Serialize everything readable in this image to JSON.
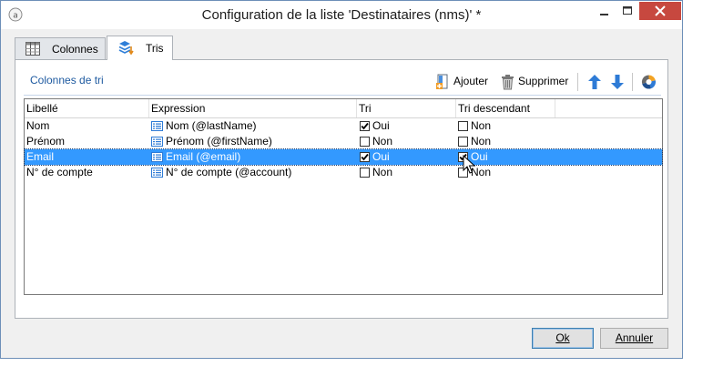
{
  "window": {
    "title": "Configuration de la liste 'Destinataires (nms)' *"
  },
  "tabs": [
    {
      "label": "Colonnes",
      "icon": "columns-icon",
      "active": false
    },
    {
      "label": "Tris",
      "icon": "sort-icon",
      "active": true
    }
  ],
  "section": {
    "title": "Colonnes de tri"
  },
  "toolbar": {
    "add_label": "Ajouter",
    "delete_label": "Supprimer",
    "up_icon": "arrow-up-icon",
    "down_icon": "arrow-down-icon",
    "chart_icon": "distribution-icon"
  },
  "grid": {
    "headers": [
      "Libellé",
      "Expression",
      "Tri",
      "Tri descendant"
    ],
    "rows": [
      {
        "label": "Nom",
        "expression": "Nom (@lastName)",
        "sort": true,
        "sort_label": "Oui",
        "desc": false,
        "desc_label": "Non",
        "selected": false
      },
      {
        "label": "Prénom",
        "expression": "Prénom (@firstName)",
        "sort": false,
        "sort_label": "Non",
        "desc": false,
        "desc_label": "Non",
        "selected": false
      },
      {
        "label": "Email",
        "expression": "Email (@email)",
        "sort": true,
        "sort_label": "Oui",
        "desc": true,
        "desc_label": "Oui",
        "selected": true
      },
      {
        "label": "N° de compte",
        "expression": "N° de compte (@account)",
        "sort": false,
        "sort_label": "Non",
        "desc": false,
        "desc_label": "Non",
        "selected": false
      }
    ]
  },
  "footer": {
    "ok_label": "Ok",
    "cancel_label": "Annuler"
  },
  "colors": {
    "selection": "#3399ff",
    "close_button": "#c7483f",
    "section_title": "#1e5aa0",
    "arrow_blue": "#2e7bd6"
  }
}
